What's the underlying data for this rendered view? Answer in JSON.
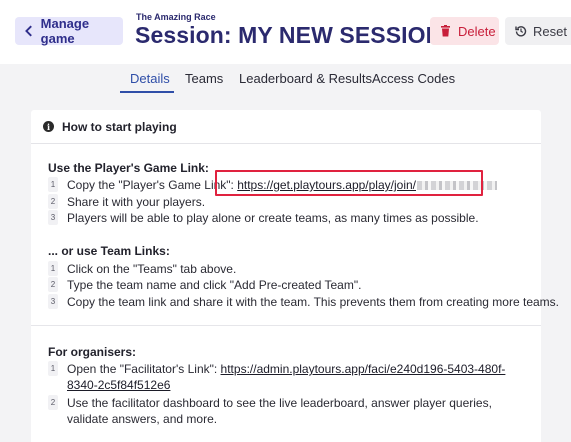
{
  "header": {
    "manage_label": "Manage game",
    "app_name": "The Amazing Race",
    "session_title": "Session: MY NEW SESSION",
    "delete_label": "Delete",
    "reset_label": "Reset"
  },
  "tabs": [
    {
      "label": "Details",
      "active": true
    },
    {
      "label": "Teams",
      "active": false
    },
    {
      "label": "Leaderboard & Results",
      "active": false
    },
    {
      "label": "Access Codes",
      "active": false
    }
  ],
  "card": {
    "title": "How to start playing",
    "player_link_section": {
      "title": "Use the Player's Game Link:",
      "steps": [
        {
          "num": "1",
          "prefix": "Copy the \"Player's Game Link\": ",
          "link": "https://get.playtours.app/play/join/"
        },
        {
          "num": "2",
          "text": "Share it with your players."
        },
        {
          "num": "3",
          "text": "Players will be able to play alone or create teams, as many times as possible."
        }
      ]
    },
    "team_links_section": {
      "title": "... or use Team Links:",
      "steps": [
        {
          "num": "1",
          "text": "Click on the \"Teams\" tab above."
        },
        {
          "num": "2",
          "text": "Type the team name and click \"Add Pre-created Team\"."
        },
        {
          "num": "3",
          "text": "Copy the team link and share it with the team. This prevents them from creating more teams."
        }
      ]
    },
    "organisers_section": {
      "title": "For organisers:",
      "steps": [
        {
          "num": "1",
          "prefix": "Open the \"Facilitator's Link\": ",
          "link": "https://admin.playtours.app/faci/e240d196-5403-480f-8340-2c5f84f512e6"
        },
        {
          "num": "2",
          "text": "Use the facilitator dashboard to see the live leaderboard, answer player queries, validate answers, and more."
        }
      ]
    }
  },
  "colors": {
    "accent": "#2f4ea8",
    "title": "#2b2a6e",
    "delete": "#c81e3a",
    "highlight": "#e0223f"
  }
}
